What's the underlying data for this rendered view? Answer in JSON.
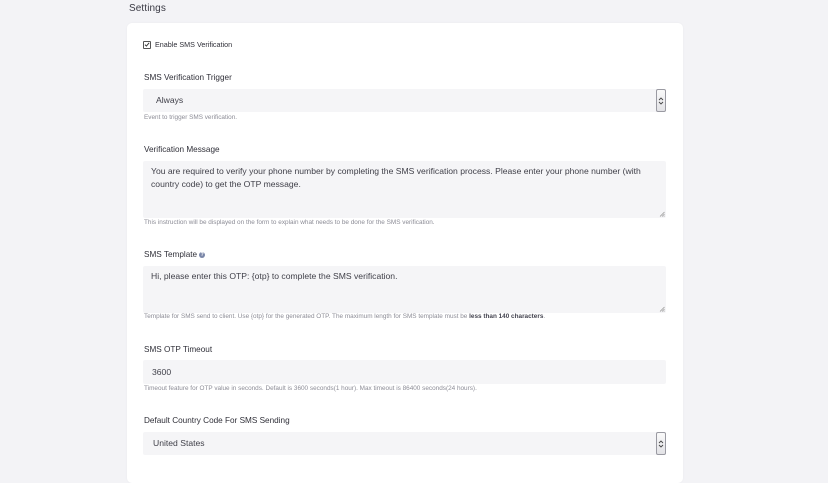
{
  "page": {
    "title": "Settings"
  },
  "sms_verification": {
    "enable_label": "Enable SMS Verification",
    "enabled": true
  },
  "trigger": {
    "label": "SMS Verification Trigger",
    "value": "Always",
    "help": "Event to trigger SMS verification."
  },
  "verification_message": {
    "label": "Verification Message",
    "value": "You are required to verify your phone number by completing the SMS verification process. Please enter your phone number (with country code) to get the OTP message.",
    "help": "This instruction will be displayed on the form to explain what needs to be done for the SMS verification."
  },
  "sms_template": {
    "label": "SMS Template",
    "help_icon": "question-circle-icon",
    "value": "Hi, please enter this OTP: {otp} to complete the SMS verification.",
    "help_prefix": "Template for SMS send to client. Use {otp} for the generated OTP. The maximum length for SMS template must be ",
    "help_bold": "less than 140 characters",
    "help_suffix": "."
  },
  "otp_timeout": {
    "label": "SMS OTP Timeout",
    "value": "3600",
    "help": "Timeout feature for OTP value in seconds. Default is 3600 seconds(1 hour). Max timeout is 86400 seconds(24 hours)."
  },
  "country_code": {
    "label": "Default Country Code For SMS Sending",
    "value": "United States"
  },
  "icons": {
    "checkbox": "checkmark-icon",
    "select": "chevron-up-down-icon",
    "resize": "resize-grip-icon"
  }
}
